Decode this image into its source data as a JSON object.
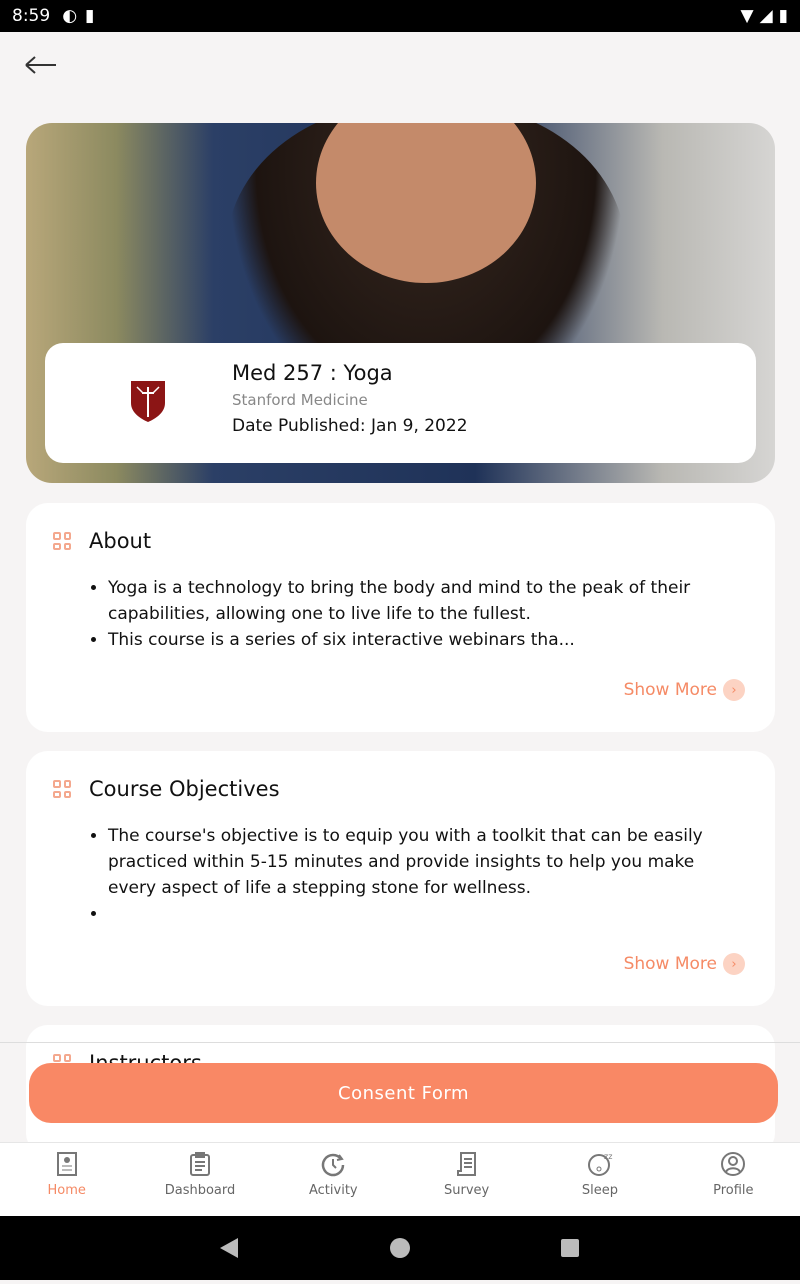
{
  "status_bar": {
    "time": "8:59"
  },
  "course": {
    "title": "Med 257 : Yoga",
    "institution": "Stanford Medicine",
    "date_published": "Date Published: Jan 9, 2022"
  },
  "about": {
    "heading": "About",
    "bullets": [
      "Yoga is a technology to bring the body and mind to the peak of their capabilities, allowing one to live life to the fullest.",
      "This course is a series of six interactive webinars tha..."
    ],
    "show_more": "Show More"
  },
  "objectives": {
    "heading": "Course Objectives",
    "bullets": [
      "The course's objective is to equip you with a toolkit that can be easily practiced within 5-15 minutes and provide insights to help you make every aspect of life a stepping stone for wellness.",
      ""
    ],
    "show_more": "Show More"
  },
  "instructors": {
    "heading": "Instructors"
  },
  "consent_button": "Consent Form",
  "accent_color": "#f98865",
  "nav": [
    {
      "label": "Home",
      "icon": "book-gear-icon",
      "active": true
    },
    {
      "label": "Dashboard",
      "icon": "clipboard-icon"
    },
    {
      "label": "Activity",
      "icon": "clock-refresh-icon"
    },
    {
      "label": "Survey",
      "icon": "scroll-icon"
    },
    {
      "label": "Sleep",
      "icon": "sleep-face-icon"
    },
    {
      "label": "Profile",
      "icon": "user-circle-icon"
    }
  ]
}
